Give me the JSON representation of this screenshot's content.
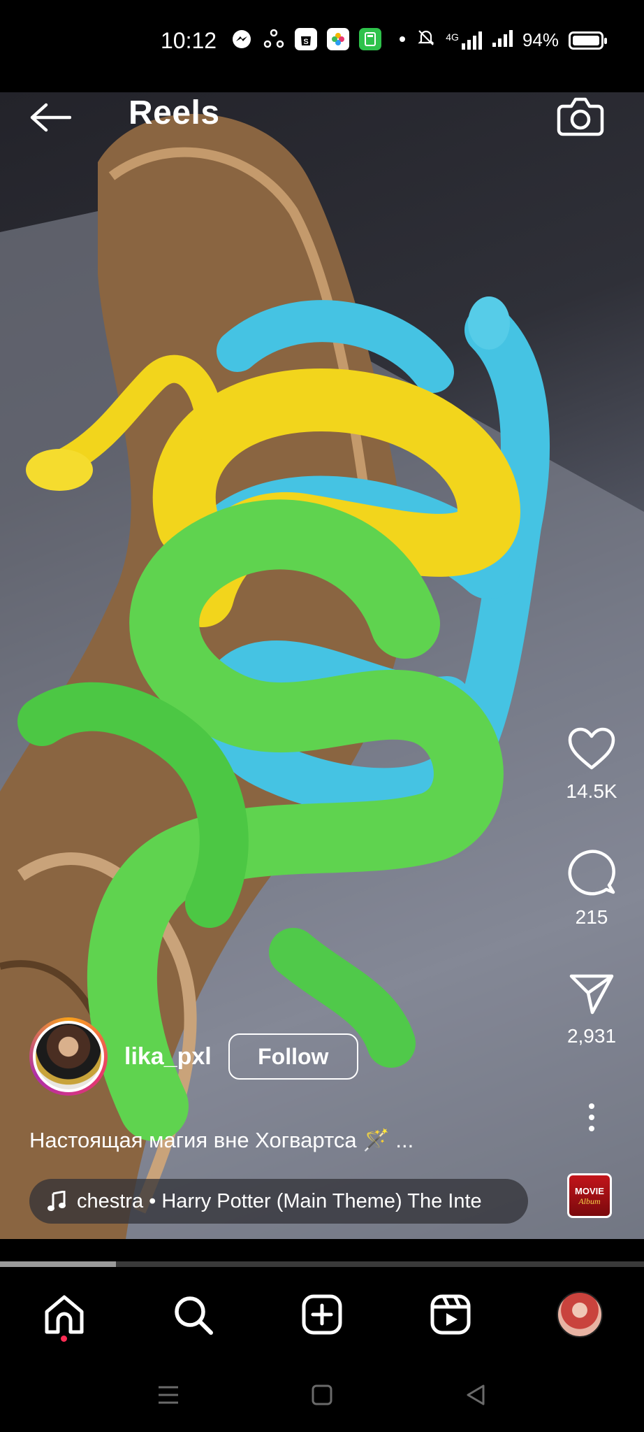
{
  "status_bar": {
    "time": "10:12",
    "battery": "94%",
    "network": "4G",
    "icons": [
      "messenger-icon",
      "connect-icon",
      "shopping-icon",
      "photos-icon",
      "calculator-icon",
      "dot-icon",
      "mute-icon",
      "signal-icon",
      "signal-icon",
      "battery-icon"
    ]
  },
  "header": {
    "title": "Reels"
  },
  "actions": {
    "likes": "14.5K",
    "comments": "215",
    "shares": "2,931"
  },
  "post": {
    "username": "lika_pxl",
    "follow_label": "Follow",
    "caption": "Настоящая магия вне Хогвартса 🪄 ...",
    "music": "chestra • Harry Potter (Main Theme)   The Inte",
    "audio_thumb_line1": "MOVIE",
    "audio_thumb_line2": "Album"
  },
  "playback": {
    "progress": 0.18
  },
  "nav": {
    "items": [
      "home-icon",
      "search-icon",
      "create-icon",
      "reels-icon",
      "profile-avatar"
    ],
    "active": "home-icon"
  },
  "colors": {
    "accent_ring_start": "#f9a21a",
    "accent_ring_end": "#b02fa8",
    "notification_dot": "#ff2d55",
    "snake_yellow": "#f2d51c",
    "snake_blue": "#45c3e3",
    "snake_green": "#5fd34f"
  }
}
